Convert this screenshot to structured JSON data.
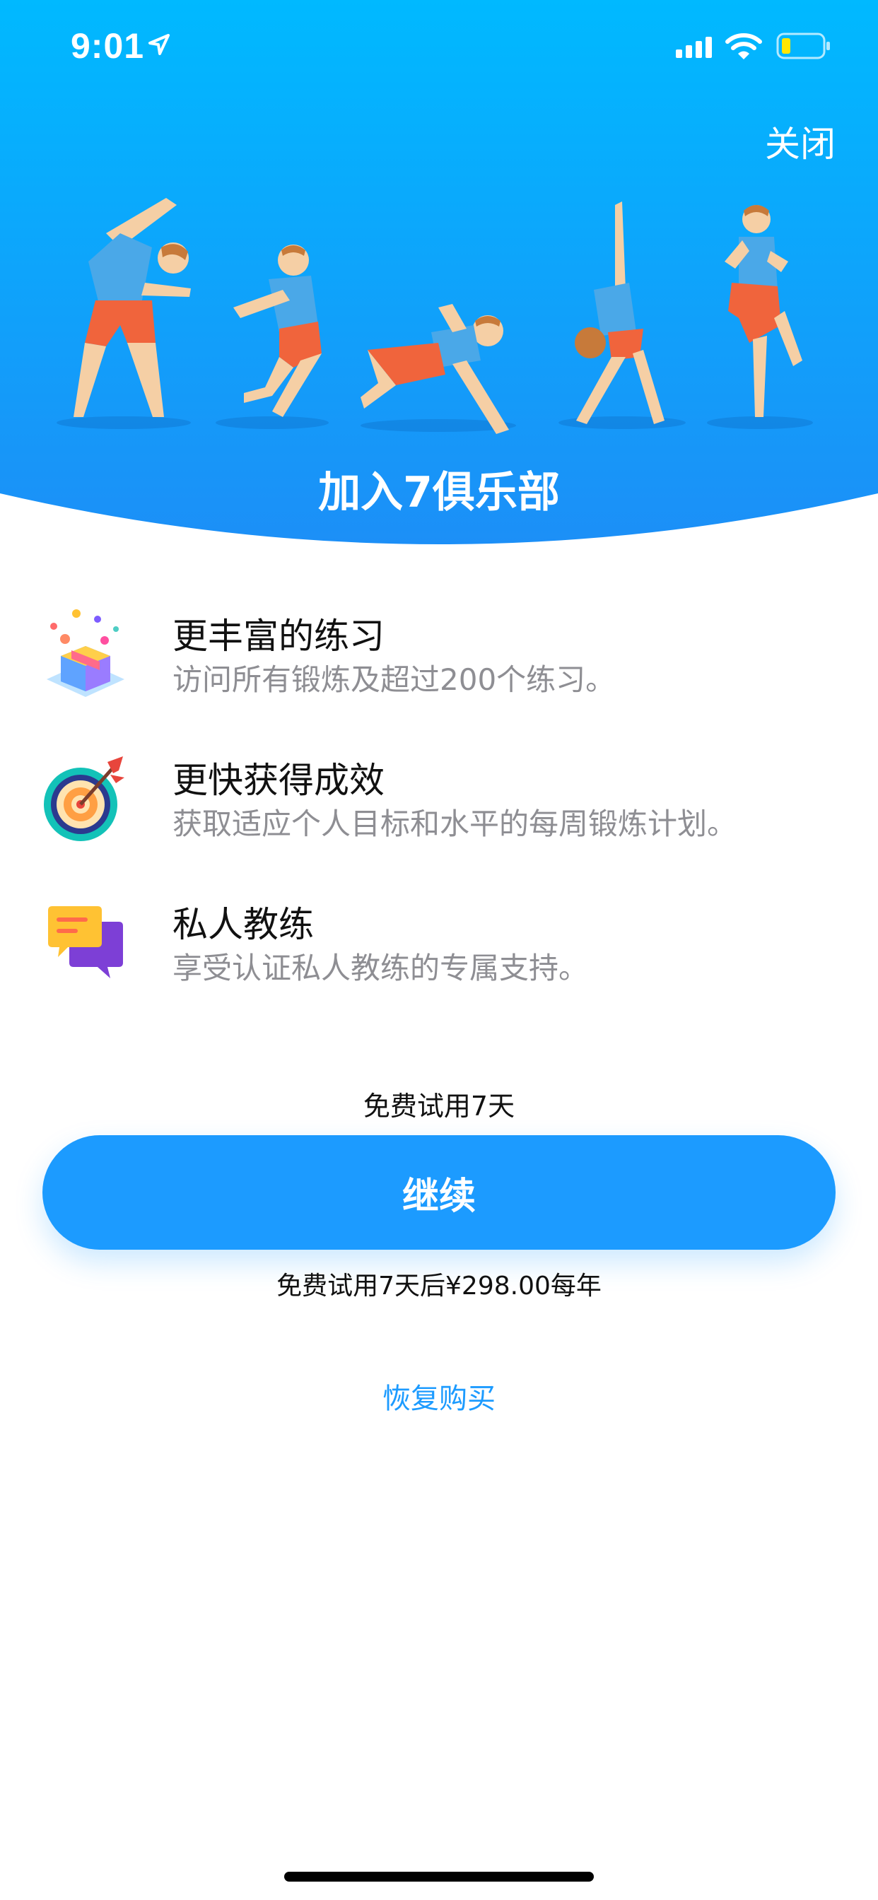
{
  "status_bar": {
    "time": "9:01",
    "icons": [
      "location-arrow-icon",
      "cellular-signal-icon",
      "wifi-icon",
      "battery-icon"
    ]
  },
  "header": {
    "close_label": "关闭",
    "headline": "加入7俱乐部"
  },
  "features": [
    {
      "icon": "gift-box-icon",
      "title": "更丰富的练习",
      "description": "访问所有锻炼及超过200个练习。"
    },
    {
      "icon": "target-icon",
      "title": "更快获得成效",
      "description": "获取适应个人目标和水平的每周锻炼计划。"
    },
    {
      "icon": "chat-bubbles-icon",
      "title": "私人教练",
      "description": "享受认证私人教练的专属支持。"
    }
  ],
  "offer": {
    "trial_label": "免费试用7天",
    "continue_label": "继续",
    "price_note": "免费试用7天后¥298.00每年",
    "restore_label": "恢复购买"
  },
  "colors": {
    "header_top": "#00b7ff",
    "header_bottom": "#1c8ff7",
    "accent": "#1c9bff",
    "description": "#8e8e93"
  }
}
